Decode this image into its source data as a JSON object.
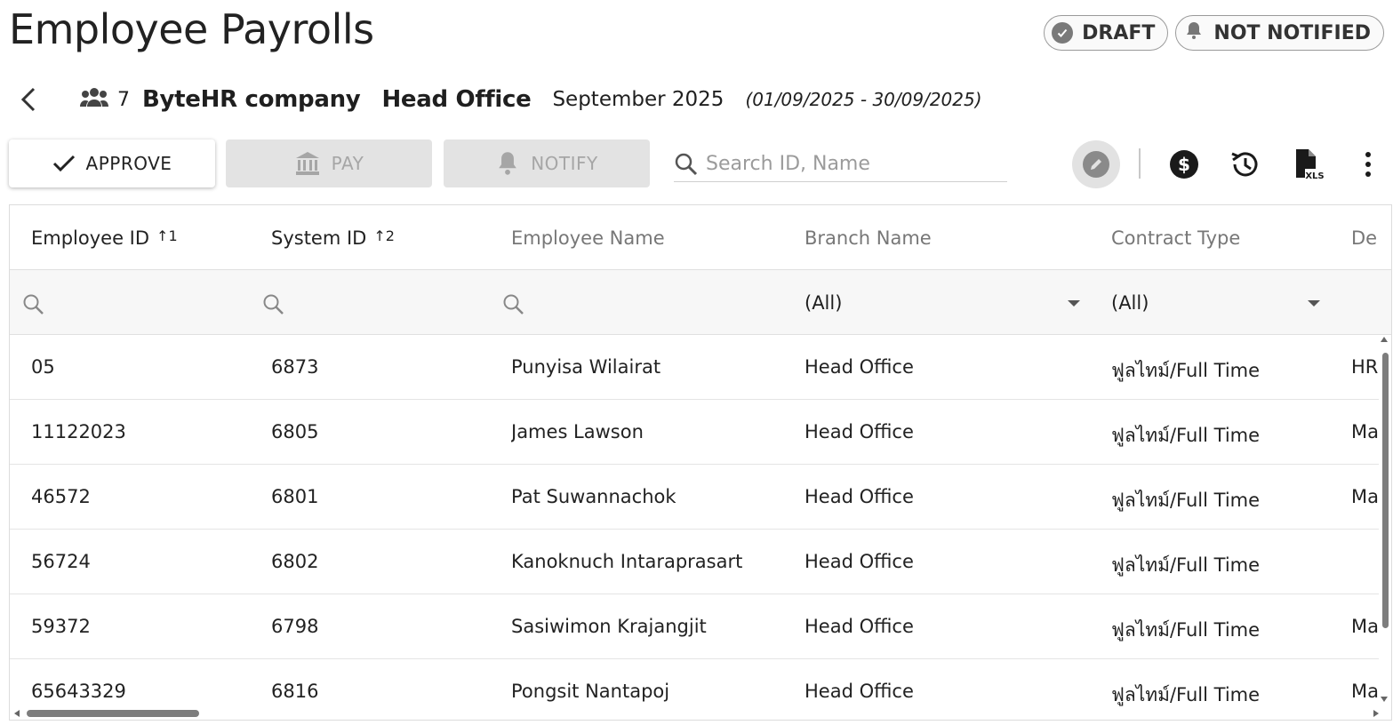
{
  "page": {
    "title": "Employee Payrolls"
  },
  "status": {
    "draft": "DRAFT",
    "notified": "NOT NOTIFIED"
  },
  "subheader": {
    "employee_count": "7",
    "company": "ByteHR company",
    "branch": "Head Office",
    "period": "September 2025",
    "range": "(01/09/2025 - 30/09/2025)"
  },
  "toolbar": {
    "approve": "APPROVE",
    "pay": "PAY",
    "notify": "NOTIFY",
    "search_placeholder": "Search ID, Name",
    "xls_label": "XLS"
  },
  "colors": {
    "accent_dark": "#222222",
    "disabled_bg": "#e3e3e3",
    "disabled_text": "#a6a6a6"
  },
  "table": {
    "columns": [
      {
        "label": "Employee ID",
        "sort": "1"
      },
      {
        "label": "System ID",
        "sort": "2"
      },
      {
        "label": "Employee Name",
        "sort": ""
      },
      {
        "label": "Branch Name",
        "sort": ""
      },
      {
        "label": "Contract Type",
        "sort": ""
      },
      {
        "label": "Dep",
        "sort": ""
      }
    ],
    "filters": {
      "branch": "(All)",
      "contract": "(All)"
    },
    "rows": [
      {
        "employee_id": "05",
        "system_id": "6873",
        "name": "Punyisa Wilairat",
        "branch": "Head Office",
        "contract": "ฟูลไทม์/Full Time",
        "dept": "HR"
      },
      {
        "employee_id": "11122023",
        "system_id": "6805",
        "name": "James Lawson",
        "branch": "Head Office",
        "contract": "ฟูลไทม์/Full Time",
        "dept": "Ma"
      },
      {
        "employee_id": "46572",
        "system_id": "6801",
        "name": "Pat Suwannachok",
        "branch": "Head Office",
        "contract": "ฟูลไทม์/Full Time",
        "dept": "Ma"
      },
      {
        "employee_id": "56724",
        "system_id": "6802",
        "name": "Kanoknuch Intaraprasart",
        "branch": "Head Office",
        "contract": "ฟูลไทม์/Full Time",
        "dept": ""
      },
      {
        "employee_id": "59372",
        "system_id": "6798",
        "name": "Sasiwimon Krajangjit",
        "branch": "Head Office",
        "contract": "ฟูลไทม์/Full Time",
        "dept": "Ma"
      },
      {
        "employee_id": "65643329",
        "system_id": "6816",
        "name": "Pongsit Nantapoj",
        "branch": "Head Office",
        "contract": "ฟูลไทม์/Full Time",
        "dept": "Ma"
      }
    ]
  }
}
